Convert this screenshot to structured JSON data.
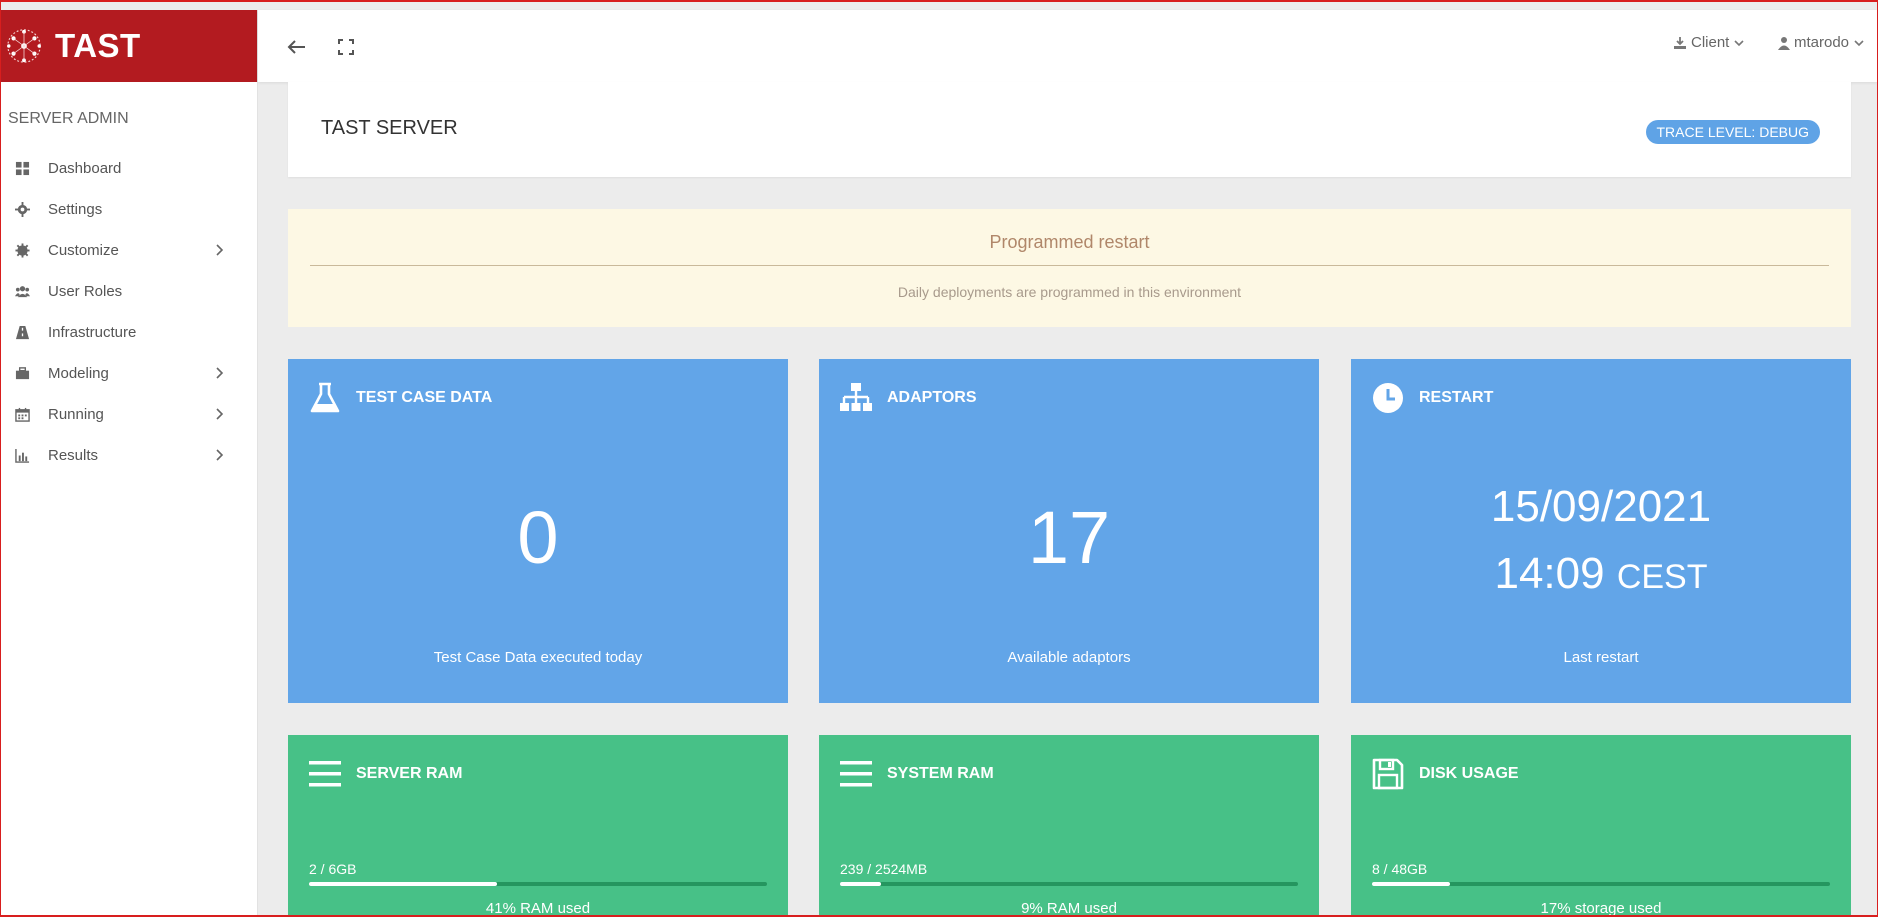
{
  "brand": {
    "name": "TAST"
  },
  "sidebar": {
    "section": "SERVER ADMIN",
    "items": [
      {
        "label": "Dashboard",
        "icon": "dashboard-icon",
        "expandable": false
      },
      {
        "label": "Settings",
        "icon": "gear-icon",
        "expandable": false
      },
      {
        "label": "Customize",
        "icon": "cog-burst-icon",
        "expandable": true
      },
      {
        "label": "User Roles",
        "icon": "users-icon",
        "expandable": false
      },
      {
        "label": "Infrastructure",
        "icon": "road-icon",
        "expandable": false
      },
      {
        "label": "Modeling",
        "icon": "briefcase-icon",
        "expandable": true
      },
      {
        "label": "Running",
        "icon": "calendar-icon",
        "expandable": true
      },
      {
        "label": "Results",
        "icon": "bar-chart-icon",
        "expandable": true
      }
    ]
  },
  "topbar": {
    "client_label": "Client",
    "user_label": "mtarodo"
  },
  "header": {
    "title": "TAST SERVER",
    "trace_badge": "TRACE LEVEL: DEBUG"
  },
  "alert": {
    "title": "Programmed restart",
    "text": "Daily deployments are programmed in this environment"
  },
  "cards": {
    "test_case": {
      "title": "TEST CASE DATA",
      "value": "0",
      "footer": "Test Case Data executed today"
    },
    "adaptors": {
      "title": "ADAPTORS",
      "value": "17",
      "footer": "Available adaptors"
    },
    "restart": {
      "title": "RESTART",
      "date": "15/09/2021",
      "time": "14:09",
      "tz": "CEST",
      "footer": "Last restart"
    },
    "server_ram": {
      "title": "SERVER RAM",
      "usage": "2 / 6GB",
      "percent": 41,
      "footer": "41% RAM used"
    },
    "system_ram": {
      "title": "SYSTEM RAM",
      "usage": "239 / 2524MB",
      "percent": 9,
      "footer": "9% RAM used"
    },
    "disk": {
      "title": "DISK USAGE",
      "usage": "8 / 48GB",
      "percent": 17,
      "footer": "17% storage used"
    }
  },
  "colors": {
    "brand": "#b31b20",
    "card_blue": "#62a5e8",
    "card_green": "#47c187",
    "badge": "#5fa3e6",
    "alert_bg": "#fdf8e4"
  }
}
